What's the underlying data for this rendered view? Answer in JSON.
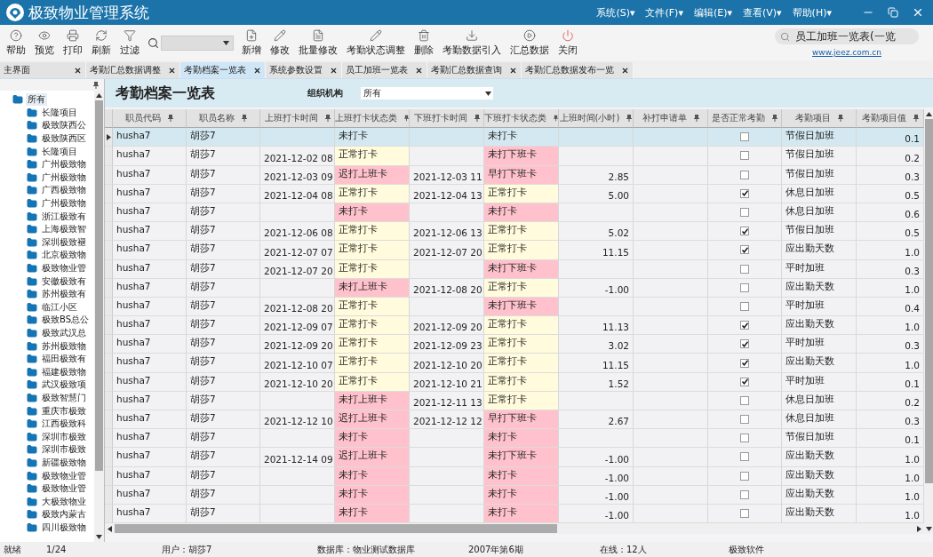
{
  "window": {
    "title": "极致物业管理系统"
  },
  "menu": [
    "系统(S)▾",
    "文件(F)▾",
    "编辑(E)▾",
    "查看(V)▾",
    "帮助(H)▾"
  ],
  "toolbar": {
    "buttons": [
      "帮助",
      "预览",
      "打印",
      "刷新",
      "过滤",
      "新增",
      "修改",
      "批量修改",
      "考勤状态调整",
      "删除",
      "考勤数据引入",
      "汇总数据",
      "关闭"
    ]
  },
  "quick_search": {
    "value": "员工加班一览表(一览"
  },
  "website": "www.jeez.com.cn",
  "tabs": [
    {
      "label": "主界面",
      "selected": false
    },
    {
      "label": "考勤汇总数据调整",
      "selected": false
    },
    {
      "label": "考勤档案一览表",
      "selected": true
    },
    {
      "label": "系统参数设置",
      "selected": false
    },
    {
      "label": "员工加班一览表",
      "selected": false
    },
    {
      "label": "考勤汇总数据查询",
      "selected": false
    },
    {
      "label": "考勤汇总数据发布一览",
      "selected": false
    }
  ],
  "tree": {
    "label": "所有",
    "selected": true,
    "children": [
      "长隆项目",
      "极致陕西公",
      "极致陕西区",
      "长隆项目",
      "广州极致物",
      "广州极致物",
      "广西极致物",
      "广州极致物",
      "浙江极致有",
      "上海极致智",
      "深圳极致褪",
      "北京极致物",
      "极致物业管",
      "安徽极致有",
      "苏州极致有",
      "临江小区",
      "极致BS总公",
      "极致武汉总",
      "苏州极致物",
      "福田极致有",
      "福建极致物",
      "武汉极致项",
      "极致智慧门",
      "重庆市极致",
      "江西极致科",
      "深圳市极致",
      "深圳市极致",
      "新疆极致物",
      "极致物业管",
      "极致物业管",
      "大极致物业",
      "极致内蒙古",
      "四川极致物"
    ]
  },
  "page_title": "考勤档案一览表",
  "org_filter": {
    "label": "组织机构",
    "value": "所有"
  },
  "table": {
    "columns": [
      "职员代码",
      "职员名称",
      "上班打卡时间",
      "上班打卡状态类",
      "下班打卡时间",
      "下班打卡状态类",
      "上班时间(小时)",
      "补打申请单",
      "是否正常考勤",
      "考勤项目",
      "考勤项目值"
    ],
    "rows": [
      {
        "selected": true,
        "code": "husha7",
        "name": "胡莎7",
        "in_time": "",
        "in_status": {
          "text": "未打卡"
        },
        "out_time": "",
        "out_status": {
          "text": "未打卡"
        },
        "hours": "",
        "normal": false,
        "item": "节假日加班",
        "value": "0.1"
      },
      {
        "selected": false,
        "code": "husha7",
        "name": "胡莎7",
        "in_time": "2021-12-02 08:",
        "in_status": {
          "text": "正常打卡",
          "kind": "normal"
        },
        "out_time": "",
        "out_status": {
          "text": "未打下班卡",
          "kind": "abnormal"
        },
        "hours": "",
        "normal": false,
        "item": "节假日加班",
        "value": "0.2"
      },
      {
        "selected": false,
        "code": "husha7",
        "name": "胡莎7",
        "in_time": "2021-12-03 09:",
        "in_status": {
          "text": "迟打上班卡",
          "kind": "abnormal"
        },
        "out_time": "2021-12-03 11:",
        "out_status": {
          "text": "早打下班卡",
          "kind": "abnormal"
        },
        "hours": "2.85",
        "normal": false,
        "item": "节假日加班",
        "value": "0.3"
      },
      {
        "selected": false,
        "code": "husha7",
        "name": "胡莎7",
        "in_time": "2021-12-04 08:",
        "in_status": {
          "text": "正常打卡",
          "kind": "normal"
        },
        "out_time": "2021-12-04 13:",
        "out_status": {
          "text": "正常打卡",
          "kind": "normal"
        },
        "hours": "5.00",
        "normal": true,
        "item": "休息日加班",
        "value": "0.5"
      },
      {
        "selected": false,
        "code": "husha7",
        "name": "胡莎7",
        "in_time": "",
        "in_status": {
          "text": "未打卡",
          "kind": "abnormal"
        },
        "out_time": "",
        "out_status": {
          "text": "未打卡",
          "kind": "abnormal"
        },
        "hours": "",
        "normal": false,
        "item": "休息日加班",
        "value": "0.6"
      },
      {
        "selected": false,
        "code": "husha7",
        "name": "胡莎7",
        "in_time": "2021-12-06 08:",
        "in_status": {
          "text": "正常打卡",
          "kind": "normal"
        },
        "out_time": "2021-12-06 13:",
        "out_status": {
          "text": "正常打卡",
          "kind": "normal"
        },
        "hours": "5.02",
        "normal": true,
        "item": "节假日加班",
        "value": "0.5"
      },
      {
        "selected": false,
        "code": "husha7",
        "name": "胡莎7",
        "in_time": "2021-12-07 07:",
        "in_status": {
          "text": "正常打卡",
          "kind": "normal"
        },
        "out_time": "2021-12-07 20:",
        "out_status": {
          "text": "正常打卡",
          "kind": "normal"
        },
        "hours": "11.15",
        "normal": true,
        "item": "应出勤天数",
        "value": "1.0"
      },
      {
        "selected": false,
        "code": "husha7",
        "name": "胡莎7",
        "in_time": "2021-12-07 20:",
        "in_status": {
          "text": "正常打卡",
          "kind": "normal"
        },
        "out_time": "",
        "out_status": {
          "text": "未打下班卡",
          "kind": "abnormal"
        },
        "hours": "",
        "normal": false,
        "item": "平时加班",
        "value": "0.3"
      },
      {
        "selected": false,
        "code": "husha7",
        "name": "胡莎7",
        "in_time": "",
        "in_status": {
          "text": "未打上班卡",
          "kind": "abnormal"
        },
        "out_time": "2021-12-08 20:",
        "out_status": {
          "text": "正常打卡",
          "kind": "normal"
        },
        "hours": "-1.00",
        "normal": false,
        "item": "应出勤天数",
        "value": "1.0"
      },
      {
        "selected": false,
        "code": "husha7",
        "name": "胡莎7",
        "in_time": "2021-12-08 20:",
        "in_status": {
          "text": "正常打卡",
          "kind": "normal"
        },
        "out_time": "",
        "out_status": {
          "text": "未打下班卡",
          "kind": "abnormal"
        },
        "hours": "",
        "normal": false,
        "item": "平时加班",
        "value": "0.4"
      },
      {
        "selected": false,
        "code": "husha7",
        "name": "胡莎7",
        "in_time": "2021-12-09 07:",
        "in_status": {
          "text": "正常打卡",
          "kind": "normal"
        },
        "out_time": "2021-12-09 20:",
        "out_status": {
          "text": "正常打卡",
          "kind": "normal"
        },
        "hours": "11.13",
        "normal": true,
        "item": "应出勤天数",
        "value": "1.0"
      },
      {
        "selected": false,
        "code": "husha7",
        "name": "胡莎7",
        "in_time": "2021-12-09 20:",
        "in_status": {
          "text": "正常打卡",
          "kind": "normal"
        },
        "out_time": "2021-12-09 23:",
        "out_status": {
          "text": "正常打卡",
          "kind": "normal"
        },
        "hours": "3.02",
        "normal": true,
        "item": "平时加班",
        "value": "0.3"
      },
      {
        "selected": false,
        "code": "husha7",
        "name": "胡莎7",
        "in_time": "2021-12-10 07:",
        "in_status": {
          "text": "正常打卡",
          "kind": "normal"
        },
        "out_time": "2021-12-10 20:",
        "out_status": {
          "text": "正常打卡",
          "kind": "normal"
        },
        "hours": "11.15",
        "normal": true,
        "item": "应出勤天数",
        "value": "1.0"
      },
      {
        "selected": false,
        "code": "husha7",
        "name": "胡莎7",
        "in_time": "2021-12-10 20:",
        "in_status": {
          "text": "正常打卡",
          "kind": "normal"
        },
        "out_time": "2021-12-10 21:",
        "out_status": {
          "text": "正常打卡",
          "kind": "normal"
        },
        "hours": "1.52",
        "normal": true,
        "item": "平时加班",
        "value": "0.1"
      },
      {
        "selected": false,
        "code": "husha7",
        "name": "胡莎7",
        "in_time": "",
        "in_status": {
          "text": "未打上班卡",
          "kind": "abnormal"
        },
        "out_time": "2021-12-11 13:",
        "out_status": {
          "text": "正常打卡",
          "kind": "normal"
        },
        "hours": "",
        "normal": false,
        "item": "休息日加班",
        "value": "0.2"
      },
      {
        "selected": false,
        "code": "husha7",
        "name": "胡莎7",
        "in_time": "2021-12-12 10:",
        "in_status": {
          "text": "迟打上班卡",
          "kind": "abnormal"
        },
        "out_time": "2021-12-12 12:",
        "out_status": {
          "text": "早打下班卡",
          "kind": "abnormal"
        },
        "hours": "2.67",
        "normal": false,
        "item": "休息日加班",
        "value": "0.3"
      },
      {
        "selected": false,
        "code": "husha7",
        "name": "胡莎7",
        "in_time": "",
        "in_status": {
          "text": "未打卡",
          "kind": "abnormal"
        },
        "out_time": "",
        "out_status": {
          "text": "未打卡",
          "kind": "abnormal"
        },
        "hours": "",
        "normal": false,
        "item": "节假日加班",
        "value": "0.1"
      },
      {
        "selected": false,
        "code": "husha7",
        "name": "胡莎7",
        "in_time": "2021-12-14 09:",
        "in_status": {
          "text": "迟打上班卡",
          "kind": "abnormal"
        },
        "out_time": "",
        "out_status": {
          "text": "未打下班卡",
          "kind": "abnormal"
        },
        "hours": "-1.00",
        "normal": false,
        "item": "应出勤天数",
        "value": "1.0"
      },
      {
        "selected": false,
        "code": "husha7",
        "name": "胡莎7",
        "in_time": "",
        "in_status": {
          "text": "未打卡",
          "kind": "abnormal"
        },
        "out_time": "",
        "out_status": {
          "text": "未打卡",
          "kind": "abnormal"
        },
        "hours": "-1.00",
        "normal": false,
        "item": "应出勤天数",
        "value": "1.0"
      },
      {
        "selected": false,
        "code": "husha7",
        "name": "胡莎7",
        "in_time": "",
        "in_status": {
          "text": "未打卡",
          "kind": "abnormal"
        },
        "out_time": "",
        "out_status": {
          "text": "未打卡",
          "kind": "abnormal"
        },
        "hours": "-1.00",
        "normal": false,
        "item": "应出勤天数",
        "value": "1.0"
      },
      {
        "selected": false,
        "code": "husha7",
        "name": "胡莎7",
        "in_time": "",
        "in_status": {
          "text": "未打卡",
          "kind": "abnormal"
        },
        "out_time": "",
        "out_status": {
          "text": "未打卡",
          "kind": "abnormal"
        },
        "hours": "-1.00",
        "normal": false,
        "item": "应出勤天数",
        "value": "1.0"
      }
    ]
  },
  "status_bar": [
    "就绪",
    "1/24",
    "用户：胡莎7",
    "数据库：物业测试数据库",
    "2007年第6期",
    "在线：12人",
    "极致软件"
  ]
}
